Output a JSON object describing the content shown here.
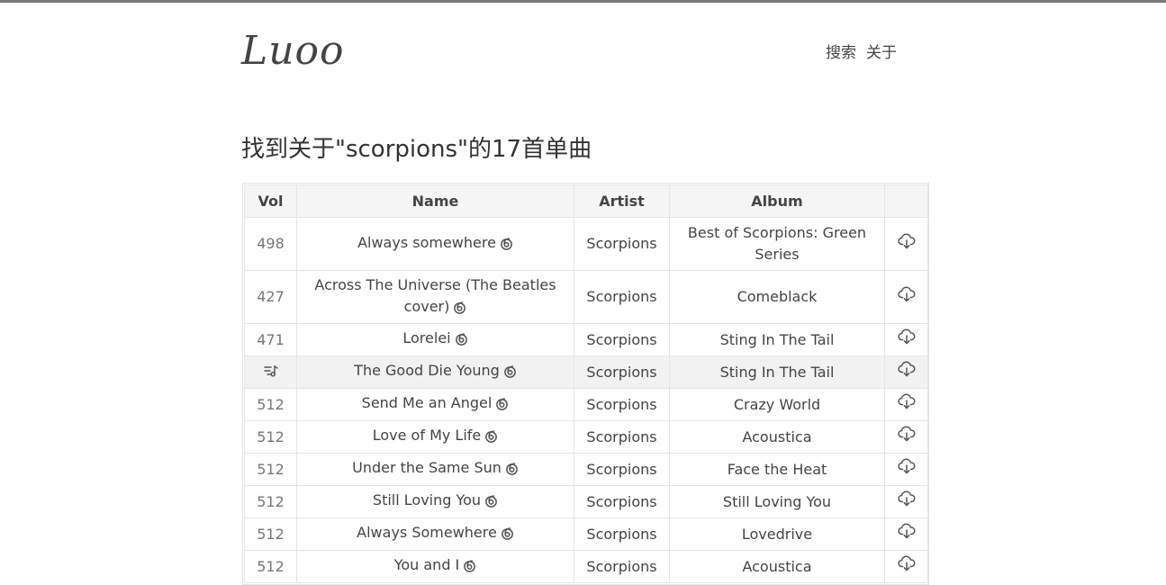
{
  "header": {
    "logo": "Luoo",
    "nav": [
      "搜索",
      "关于"
    ]
  },
  "result_title": "找到关于\"scorpions\"的17首单曲",
  "table": {
    "columns": [
      "Vol",
      "Name",
      "Artist",
      "Album",
      ""
    ],
    "rows": [
      {
        "vol": "498",
        "name": "Always somewhere",
        "artist": "Scorpions",
        "album": "Best of Scorpions: Green Series",
        "tall": true,
        "playing": false
      },
      {
        "vol": "427",
        "name": "Across The Universe (The Beatles cover)",
        "artist": "Scorpions",
        "album": "Comeblack",
        "tall": true,
        "playing": false
      },
      {
        "vol": "471",
        "name": "Lorelei",
        "artist": "Scorpions",
        "album": "Sting In The Tail",
        "tall": false,
        "playing": false
      },
      {
        "vol": "",
        "name": "The Good Die Young",
        "artist": "Scorpions",
        "album": "Sting In The Tail",
        "tall": false,
        "playing": true
      },
      {
        "vol": "512",
        "name": "Send Me an Angel",
        "artist": "Scorpions",
        "album": "Crazy World",
        "tall": false,
        "playing": false
      },
      {
        "vol": "512",
        "name": "Love of My Life",
        "artist": "Scorpions",
        "album": "Acoustica",
        "tall": false,
        "playing": false
      },
      {
        "vol": "512",
        "name": "Under the Same Sun",
        "artist": "Scorpions",
        "album": "Face the Heat",
        "tall": false,
        "playing": false
      },
      {
        "vol": "512",
        "name": "Still Loving You",
        "artist": "Scorpions",
        "album": "Still Loving You",
        "tall": false,
        "playing": false
      },
      {
        "vol": "512",
        "name": "Always Somewhere",
        "artist": "Scorpions",
        "album": "Lovedrive",
        "tall": false,
        "playing": false
      },
      {
        "vol": "512",
        "name": "You and I",
        "artist": "Scorpions",
        "album": "Acoustica",
        "tall": false,
        "playing": false
      }
    ]
  },
  "icons": {
    "name_action": "swirl-icon",
    "download": "cloud-download-icon",
    "now_playing": "now-playing-icon"
  }
}
